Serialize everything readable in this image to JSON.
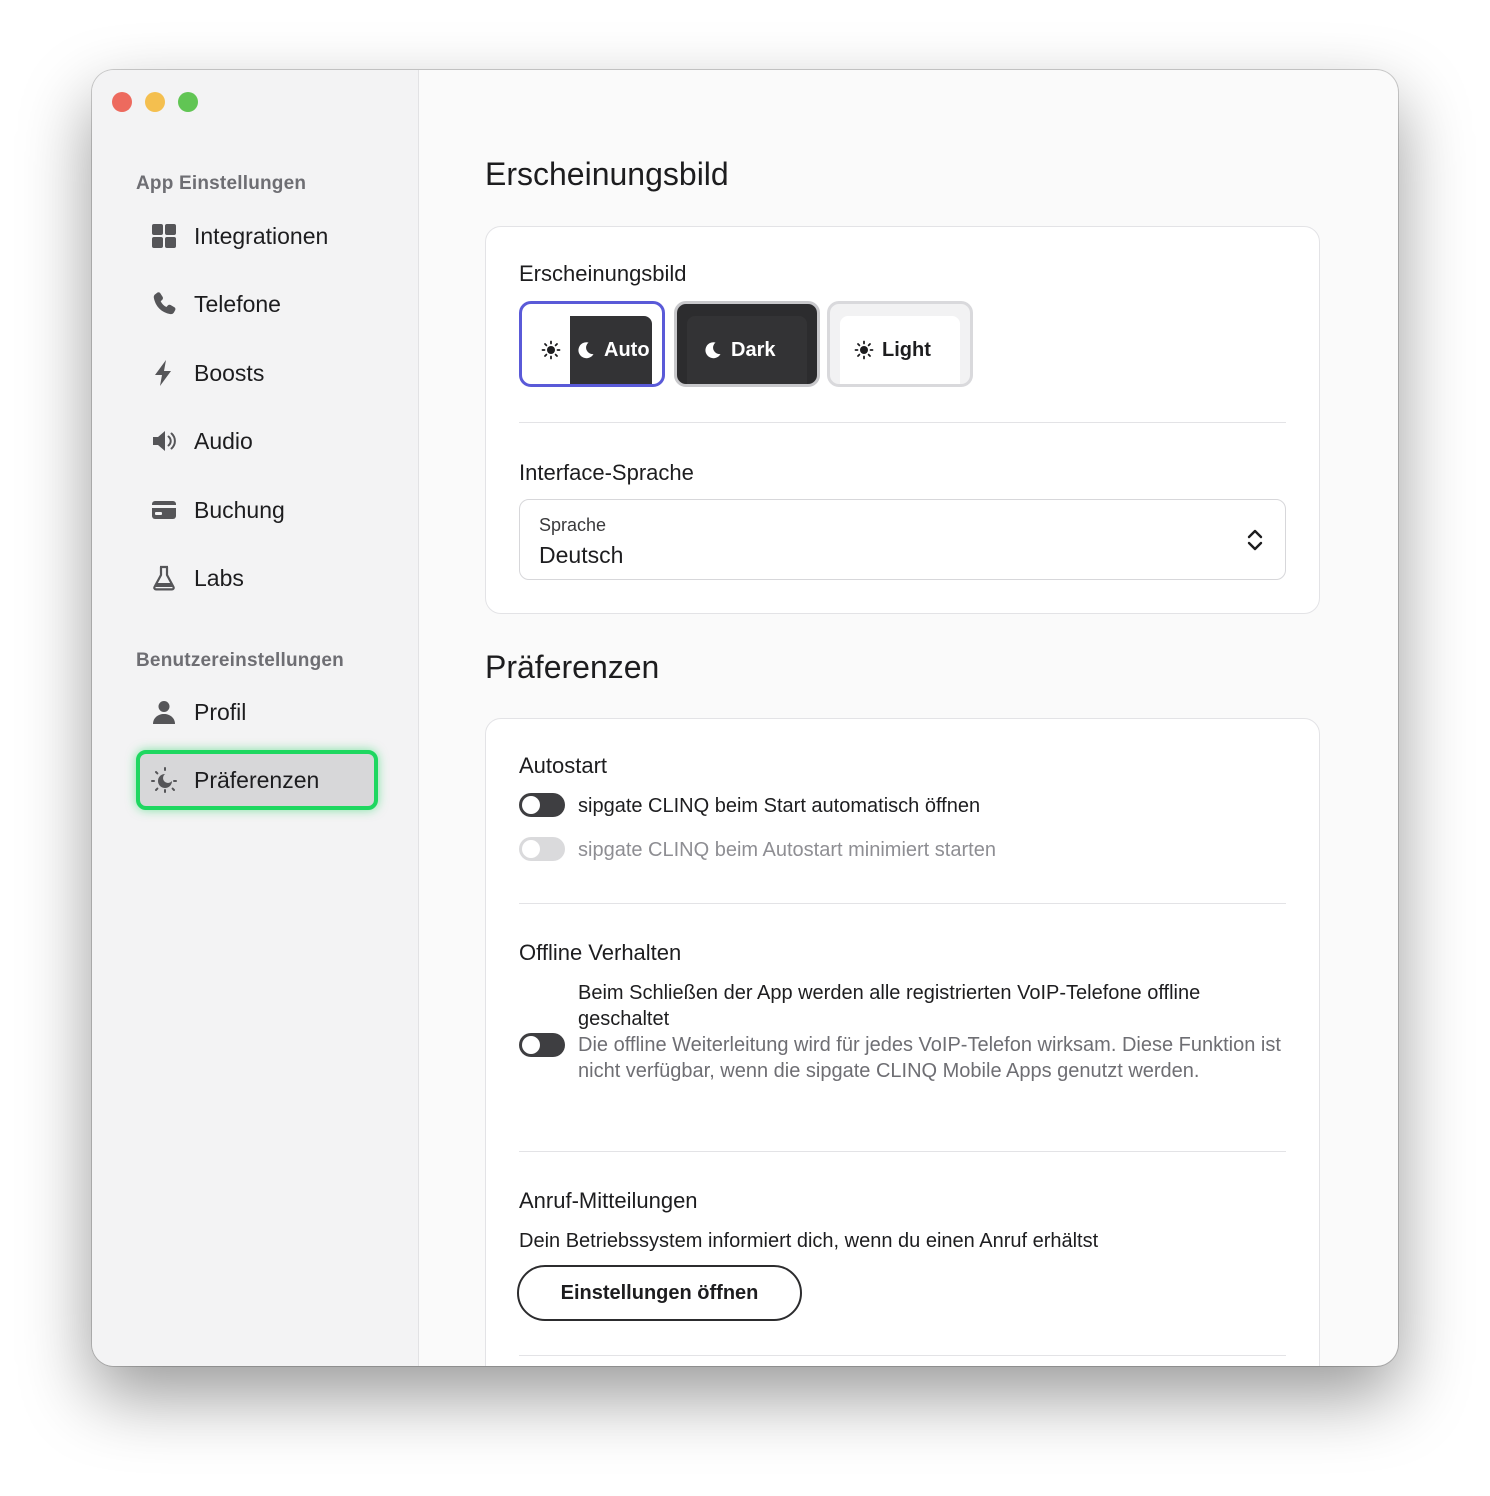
{
  "sidebar": {
    "app_section_title": "App Einstellungen",
    "user_section_title": "Benutzereinstellungen",
    "items": {
      "integrationen": "Integrationen",
      "telefone": "Telefone",
      "boosts": "Boosts",
      "audio": "Audio",
      "buchung": "Buchung",
      "labs": "Labs",
      "profil": "Profil",
      "praeferenzen": "Präferenzen"
    },
    "active_item": "praeferenzen"
  },
  "appearance": {
    "section_title": "Erscheinungsbild",
    "card_title": "Erscheinungsbild",
    "themes": {
      "auto": "Auto",
      "dark": "Dark",
      "light": "Light"
    },
    "selected_theme": "auto",
    "language_heading": "Interface-Sprache",
    "language_caption": "Sprache",
    "language_value": "Deutsch"
  },
  "preferences": {
    "section_title": "Präferenzen",
    "autostart": {
      "title": "Autostart",
      "open_on_start": {
        "label": "sipgate CLINQ beim Start automatisch öffnen",
        "enabled": false
      },
      "start_minimized": {
        "label": "sipgate CLINQ beim Autostart minimiert starten",
        "enabled": false,
        "disabled": true
      }
    },
    "offline": {
      "title": "Offline Verhalten",
      "toggle_enabled": false,
      "description_main": "Beim Schließen der App werden alle registrierten VoIP-Telefone offline geschaltet",
      "description_secondary": "Die offline Weiterleitung wird für jedes VoIP-Telefon wirksam. Diese Funktion ist nicht verfügbar, wenn die sipgate CLINQ Mobile Apps genutzt werden."
    },
    "call_notifications": {
      "title": "Anruf-Mitteilungen",
      "description": "Dein Betriebssystem informiert dich, wenn du einen Anruf erhältst",
      "button_label": "Einstellungen öffnen"
    }
  },
  "colors": {
    "accent_selected": "#5a5ad8",
    "active_highlight": "#1ed760",
    "traffic_red": "#ed6a5e",
    "traffic_yellow": "#f4bf4f",
    "traffic_green": "#61c554"
  }
}
